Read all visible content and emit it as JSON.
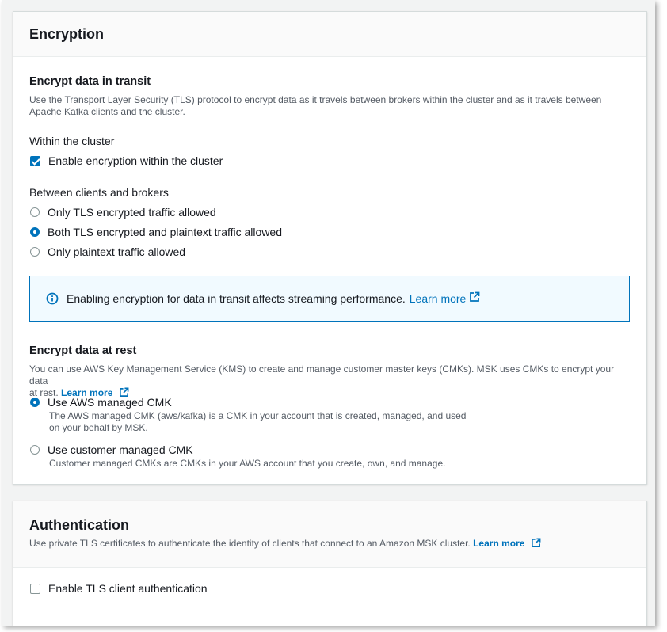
{
  "encryption": {
    "title": "Encryption",
    "transit": {
      "heading": "Encrypt data in transit",
      "description_line1": "Use the Transport Layer Security (TLS) protocol to encrypt data as it travels between brokers within the cluster and as it travels between",
      "description_line2": "Apache Kafka clients and the cluster.",
      "within_cluster_label": "Within the cluster",
      "within_cluster_checkbox": {
        "label": "Enable encryption within the cluster",
        "checked": true
      },
      "between_label": "Between clients and brokers",
      "options": [
        {
          "label": "Only TLS encrypted traffic allowed",
          "selected": false
        },
        {
          "label": "Both TLS encrypted and plaintext traffic allowed",
          "selected": true
        },
        {
          "label": "Only plaintext traffic allowed",
          "selected": false
        }
      ],
      "info": {
        "text": "Enabling encryption for data in transit affects streaming performance.",
        "link": "Learn more",
        "icon": "info-icon"
      }
    },
    "rest": {
      "heading": "Encrypt data at rest",
      "description_line1": "You can use AWS Key Management Service (KMS) to create and manage customer master keys (CMKs). MSK uses CMKs to encrypt your data",
      "description_line2": "at rest.",
      "link": "Learn more",
      "options": [
        {
          "label": "Use AWS managed CMK",
          "selected": true,
          "sub_line1": "The AWS managed CMK (aws/kafka) is a CMK in your account that is created, managed, and used",
          "sub_line2": "on your behalf by MSK."
        },
        {
          "label": "Use customer managed CMK",
          "selected": false,
          "sub_line1": "Customer managed CMKs are CMKs in your AWS account that you create, own, and manage."
        }
      ]
    }
  },
  "authentication": {
    "title": "Authentication",
    "description": "Use private TLS certificates to authenticate the identity of clients that connect to an Amazon MSK cluster.",
    "link": "Learn more",
    "checkbox": {
      "label": "Enable TLS client authentication",
      "checked": false
    }
  },
  "colors": {
    "accent": "#0073bb",
    "info_background": "#f1faff",
    "page_background": "#f2f3f3"
  }
}
